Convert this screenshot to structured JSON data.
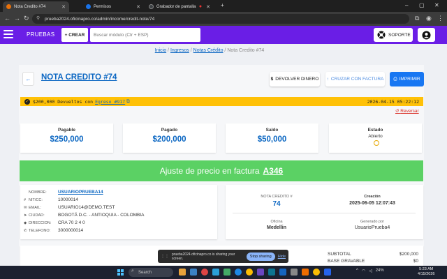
{
  "browser": {
    "tabs": [
      {
        "title": "Nota Credito #74",
        "active": true,
        "favicon_color": "#e8710a"
      },
      {
        "title": "Permisos",
        "active": false,
        "favicon_color": "#1a73e8"
      },
      {
        "title": "Grabador de pantalla",
        "active": false,
        "favicon_color": "#3c4043"
      }
    ],
    "url": "prueba2024.oficinapro.co/admin/income/credit-note/74"
  },
  "navbar": {
    "brand": "PRUEBAS",
    "crear_label": "CREAR",
    "search_placeholder": "Buscar módulo (Ctr + ESP)",
    "soporte_label": "SOPORTE",
    "bg_color": "#6a1ee6"
  },
  "breadcrumb": {
    "items": [
      "Inicio",
      "Ingresos",
      "Notas Crédito"
    ],
    "current": "Nota Credito #74",
    "separator": "/"
  },
  "header": {
    "title": "NOTA CREDITO #74",
    "devolver_label": "DEVOLVER DINERO",
    "cruzar_label": "CRUZAR CON FACTURA",
    "imprimir_label": "IMPRIMIR"
  },
  "notice": {
    "text": "$200,000 Devueltos con",
    "link": "Egreso #917",
    "date": "2026-04-15 05:22:12",
    "reversar_label": "Reversar",
    "color": "#ffc107"
  },
  "stats": {
    "pagable": {
      "label": "Pagable",
      "value": "$250,000"
    },
    "pagado": {
      "label": "Pagado",
      "value": "$200,000"
    },
    "saldo": {
      "label": "Saldo",
      "value": "$50,000"
    },
    "estado": {
      "label": "Estado",
      "value": "Abierto"
    }
  },
  "ajuste": {
    "text": "Ajuste de precio en factura",
    "invoice": "A346",
    "color": "#5bd164"
  },
  "client": {
    "rows": [
      {
        "icon": "",
        "label": "NOMBRE:",
        "value": "USUARIOPRUEBA14"
      },
      {
        "icon": "#",
        "label": "NIT/CC:",
        "value": "10000014"
      },
      {
        "icon": "✉",
        "label": "EMAIL:",
        "value": "USUARIO14@DEMO.TEST"
      },
      {
        "icon": "➤",
        "label": "CIUDAD:",
        "value": "BOGOTÁ D.C. - ANTIOQUIA - COLOMBIA"
      },
      {
        "icon": "◆",
        "label": "DIRECCION:",
        "value": "CRA 70 2 4 0"
      },
      {
        "icon": "✆",
        "label": "TELEFONO:",
        "value": "3000000014"
      }
    ]
  },
  "doc": {
    "num_label": "NOTA CREDITO #",
    "num_value": "74",
    "creacion_label": "Creación",
    "creacion_value": "2025-06-05 12:07:43",
    "oficina_label": "Oficina",
    "oficina_value": "Medellin",
    "generado_label": "Generado por",
    "generado_value": "UsuarioPrueba4"
  },
  "totals": {
    "subtotal_label": "SUBTOTAL",
    "subtotal_value": "$200,000",
    "base_label": "BASE GRAVABLE",
    "base_value": "$0"
  },
  "sharebar": {
    "text": "prueba2024.oficinapro.co is sharing your screen.",
    "stop_label": "Stop sharing",
    "hide_label": "Hide"
  },
  "taskbar": {
    "search_label": "Search",
    "battery": "24%",
    "time": "5:23 AM",
    "date": "4/15/2026"
  }
}
